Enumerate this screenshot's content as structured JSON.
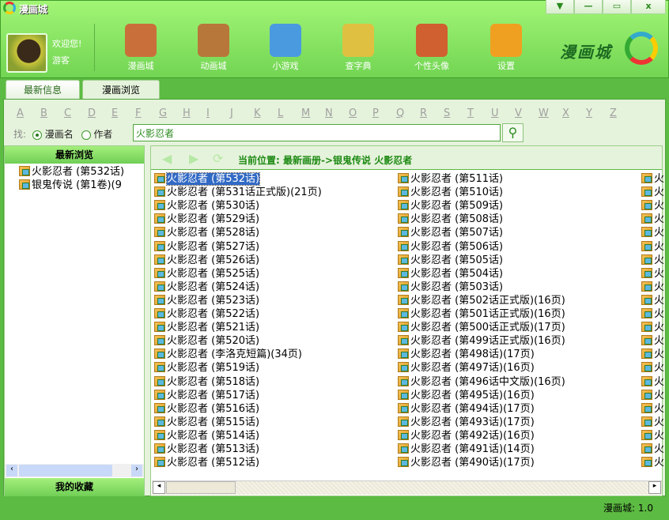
{
  "window": {
    "title": "漫画城",
    "controls": [
      "▼",
      "—",
      "▭",
      "x"
    ]
  },
  "user": {
    "welcome": "欢迎您!",
    "name": "游客"
  },
  "toolbar": [
    {
      "label": "漫画城",
      "icon": "house-icon",
      "color": "#c9703a"
    },
    {
      "label": "动画城",
      "icon": "signpost-icon",
      "color": "#b8773a"
    },
    {
      "label": "小游戏",
      "icon": "blocks-icon",
      "color": "#4a9ae0"
    },
    {
      "label": "查字典",
      "icon": "magnifier-icon",
      "color": "#e0c040"
    },
    {
      "label": "个性头像",
      "icon": "person-icon",
      "color": "#d06030"
    },
    {
      "label": "设置",
      "icon": "gear-icon",
      "color": "#f0a020"
    }
  ],
  "brand": "漫画城",
  "tabs": [
    "最新信息",
    "漫画浏览"
  ],
  "letters": [
    "A",
    "B",
    "C",
    "D",
    "E",
    "F",
    "G",
    "H",
    "I",
    "J",
    "K",
    "L",
    "M",
    "N",
    "O",
    "P",
    "Q",
    "R",
    "S",
    "T",
    "U",
    "V",
    "W",
    "X",
    "Y",
    "Z"
  ],
  "search": {
    "label": "找:",
    "opt1": "漫画名",
    "opt2": "作者",
    "value": "火影忍者"
  },
  "left": {
    "header": "最新浏览",
    "items": [
      "火影忍者 (第532话)",
      "银鬼传说 (第1卷)(9"
    ],
    "footer": "我的收藏"
  },
  "right": {
    "crumb": "当前位置: 最新画册->银鬼传说 火影忍者",
    "col1": [
      "火影忍者 (第532话)",
      "火影忍者 (第531话正式版)(21页)",
      "火影忍者 (第530话)",
      "火影忍者 (第529话)",
      "火影忍者 (第528话)",
      "火影忍者 (第527话)",
      "火影忍者 (第526话)",
      "火影忍者 (第525话)",
      "火影忍者 (第524话)",
      "火影忍者 (第523话)",
      "火影忍者 (第522话)",
      "火影忍者 (第521话)",
      "火影忍者 (第520话)",
      "火影忍者 (李洛克短篇)(34页)",
      "火影忍者 (第519话)",
      "火影忍者 (第518话)",
      "火影忍者 (第517话)",
      "火影忍者 (第516话)",
      "火影忍者 (第515话)",
      "火影忍者 (第514话)",
      "火影忍者 (第513话)",
      "火影忍者 (第512话)"
    ],
    "col2": [
      "火影忍者 (第511话)",
      "火影忍者 (第510话)",
      "火影忍者 (第509话)",
      "火影忍者 (第508话)",
      "火影忍者 (第507话)",
      "火影忍者 (第506话)",
      "火影忍者 (第505话)",
      "火影忍者 (第504话)",
      "火影忍者 (第503话)",
      "火影忍者 (第502话正式版)(16页)",
      "火影忍者 (第501话正式版)(16页)",
      "火影忍者 (第500话正式版)(17页)",
      "火影忍者 (第499话正式版)(16页)",
      "火影忍者 (第498话)(17页)",
      "火影忍者 (第497话)(16页)",
      "火影忍者 (第496话中文版)(16页)",
      "火影忍者 (第495话)(16页)",
      "火影忍者 (第494话)(17页)",
      "火影忍者 (第493话)(17页)",
      "火影忍者 (第492话)(16页)",
      "火影忍者 (第491话)(14页)",
      "火影忍者 (第490话)(17页)"
    ],
    "col3": [
      "火",
      "火",
      "火",
      "火",
      "火",
      "火",
      "火",
      "火",
      "火",
      "火",
      "火",
      "火",
      "火",
      "火",
      "火",
      "火",
      "火",
      "火",
      "火",
      "火",
      "火",
      "火"
    ]
  },
  "status": "漫画城: 1.0"
}
